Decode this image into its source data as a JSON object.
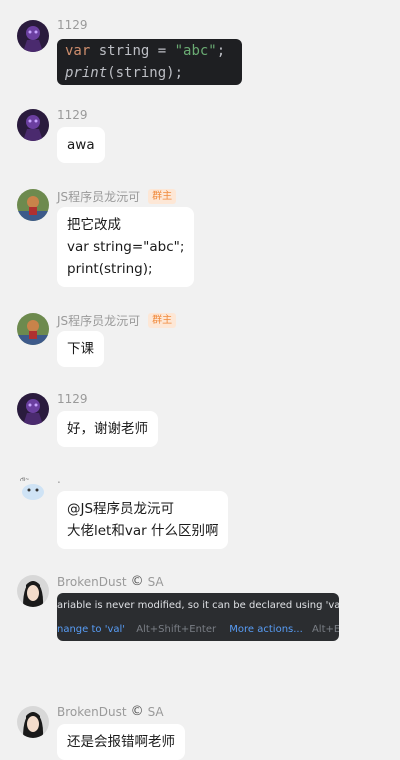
{
  "messages": [
    {
      "name": "1129"
    },
    {
      "name": "1129",
      "text": "awa"
    },
    {
      "name": "JS程序员龙沅可",
      "badge": "群主",
      "text": "把它改成\nvar string=\"abc\";\nprint(string);"
    },
    {
      "name": "JS程序员龙沅可",
      "badge": "群主",
      "text": "下课"
    },
    {
      "name": "1129",
      "text": "好，谢谢老师"
    },
    {
      "name": ".",
      "text": "@JS程序员龙沅可\n大佬let和var 什么区别啊"
    },
    {
      "name": "BrokenDust",
      "suffix": "SA"
    },
    {
      "name": "BrokenDust",
      "suffix": "SA",
      "text": "还是会报错啊老师"
    }
  ],
  "code": {
    "line1": {
      "kw": "var",
      "plain": " string = ",
      "str": "\"abc\"",
      "end": ";"
    },
    "line2": {
      "fn": "print",
      "rest": "(string);"
    }
  },
  "tooltip": {
    "message": "ariable is never modified, so it can be declared using 'val'",
    "action": "nange to 'val'",
    "action_shortcut": "Alt+Shift+Enter",
    "more": "More actions...",
    "more_shortcut": "Alt+Enter"
  },
  "icons": {
    "copyright": "©"
  }
}
